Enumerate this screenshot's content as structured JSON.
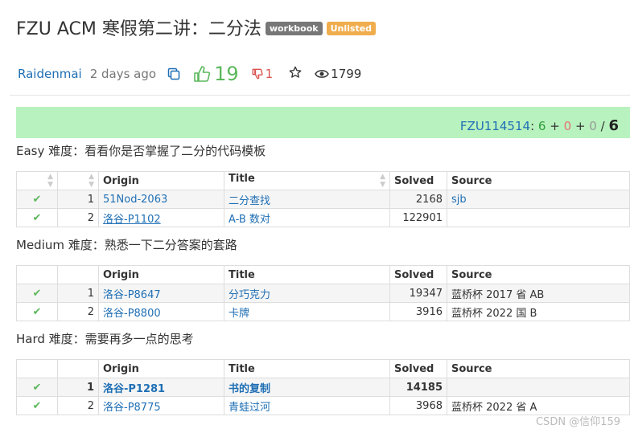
{
  "header": {
    "title": "FZU ACM 寒假第二讲：二分法",
    "badge_workbook": "workbook",
    "badge_unlisted": "Unlisted"
  },
  "meta": {
    "author": "Raidenmai",
    "time": "2 days ago",
    "likes": "19",
    "dislikes": "1",
    "views": "1799"
  },
  "progress": {
    "user": "FZU114514",
    "colon": ":",
    "accepted": "6",
    "plus1": "+",
    "wrong": "0",
    "plus2": "+",
    "other": "0",
    "slash": "/",
    "total": "6"
  },
  "sections": [
    {
      "title": "Easy 难度：看看你是否掌握了二分的代码模板",
      "headers": {
        "origin": "Origin",
        "title": "Title",
        "solved": "Solved",
        "source": "Source"
      },
      "rows": [
        {
          "num": "1",
          "origin": "51Nod-2063",
          "title": "二分查找",
          "solved": "2168",
          "source": "sjb"
        },
        {
          "num": "2",
          "origin": "洛谷-P1102",
          "title": "A-B 数对",
          "solved": "122901",
          "source": ""
        }
      ]
    },
    {
      "title": "Medium 难度：熟悉一下二分答案的套路",
      "headers": {
        "origin": "Origin",
        "title": "Title",
        "solved": "Solved",
        "source": "Source"
      },
      "rows": [
        {
          "num": "1",
          "origin": "洛谷-P8647",
          "title": "分巧克力",
          "solved": "19347",
          "source": "蓝桥杯 2017 省 AB"
        },
        {
          "num": "2",
          "origin": "洛谷-P8800",
          "title": "卡牌",
          "solved": "3916",
          "source": "蓝桥杯 2022 国 B"
        }
      ]
    },
    {
      "title": "Hard 难度：需要再多一点的思考",
      "headers": {
        "origin": "Origin",
        "title": "Title",
        "solved": "Solved",
        "source": "Source"
      },
      "rows": [
        {
          "num": "1",
          "origin": "洛谷-P1281",
          "title": "书的复制",
          "solved": "14185",
          "source": ""
        },
        {
          "num": "2",
          "origin": "洛谷-P8775",
          "title": "青蛙过河",
          "solved": "3968",
          "source": "蓝桥杯 2022 省 A"
        }
      ]
    }
  ],
  "watermark": "CSDN @信仰159",
  "colors": {
    "progress_bg": "#b8f2be",
    "link": "#1f6fb5",
    "like": "#5cb85c",
    "dislike": "#d9534f",
    "badge_gray": "#777777",
    "badge_orange": "#f0ad4e"
  }
}
